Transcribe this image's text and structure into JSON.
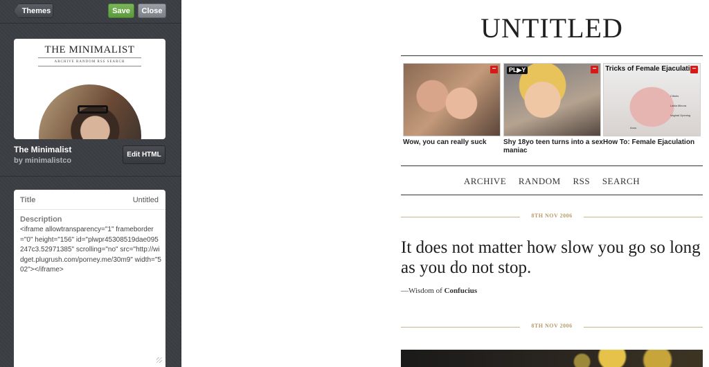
{
  "editor": {
    "back_label": "Themes",
    "save_label": "Save",
    "close_label": "Close",
    "theme": {
      "thumbnail_title": "THE MINIMALIST",
      "thumbnail_nav": "ARCHIVE    RANDOM    RSS    SEARCH",
      "name": "The Minimalist",
      "author": "by minimalistco"
    },
    "edit_html_label": "Edit HTML",
    "fields": {
      "title_label": "Title",
      "title_value": "Untitled",
      "description_label": "Description",
      "description_value": "<iframe allowtransparency=\"1\" frameborder=\"0\" height=\"156\" id=\"plwpr45308519dae095247c3.52971385\" scrolling=\"no\" src=\"http://widget.plugrush.com/porney.me/30m9\" width=\"502\"></iframe>"
    }
  },
  "preview": {
    "blog_title": "UNTITLED",
    "ads": [
      {
        "caption": "Wow, you can really suck",
        "close": "−"
      },
      {
        "caption": "Shy 18yo teen turns into a sex maniac",
        "badge": "PL▶Y",
        "close": "−"
      },
      {
        "caption": "How To: Female Ejaculation",
        "image_title": "Tricks of Female Ejaculation",
        "labels": [
          "Clitoris",
          "Labia Minora",
          "Vaginal Opening",
          "Anus"
        ],
        "close": "−"
      }
    ],
    "nav": [
      "ARCHIVE",
      "RANDOM",
      "RSS",
      "SEARCH"
    ],
    "posts": [
      {
        "date": "8TH NOV 2006",
        "quote": "It does not matter how slow you go so long as you do not stop.",
        "source_prefix": "—Wisdom of",
        "source_name": "Confucius"
      },
      {
        "date": "8TH NOV 2006"
      }
    ]
  }
}
